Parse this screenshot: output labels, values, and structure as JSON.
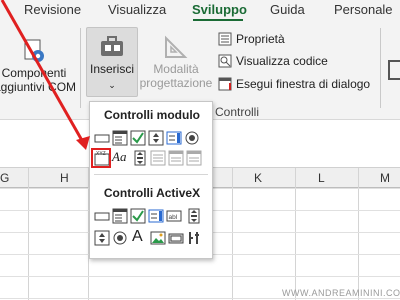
{
  "tabs": [
    "Revisione",
    "Visualizza",
    "Sviluppo",
    "Guida",
    "Personale"
  ],
  "active_tab": "Sviluppo",
  "ribbon": {
    "componenti_line1": "Componenti",
    "componenti_line2": "aggiuntivi COM",
    "inserisci_label": "Inserisci",
    "modalita_line1": "Modalità",
    "modalita_line2": "progettazione",
    "proprieta": "Proprietà",
    "visualizza_codice": "Visualizza codice",
    "esegui_finestra": "Esegui finestra di dialogo",
    "group_controlli": "Controlli"
  },
  "columns": [
    "G",
    "H",
    "K",
    "L",
    "M"
  ],
  "dropdown": {
    "controlli_modulo": "Controlli modulo",
    "controlli_activex": "Controlli ActiveX",
    "form_icons": [
      "button-icon",
      "combo-box-icon",
      "checkbox-icon",
      "list-box-icon",
      "option-button-icon",
      "label-icon",
      "group-box-icon",
      "scroll-bar-icon",
      "text-field-icon",
      "combo-list-edit-icon",
      "combo-dropdown-edit-icon"
    ],
    "activex_icons": [
      "command-button-icon",
      "combo-box-icon",
      "checkbox-icon",
      "list-box-icon",
      "text-box-icon",
      "scroll-bar-icon",
      "spin-button-icon",
      "option-button-icon",
      "label-icon",
      "image-icon",
      "toggle-button-icon",
      "more-controls-icon"
    ]
  },
  "colors": {
    "accent": "#1a6b35",
    "highlight": "#e02020"
  },
  "watermark": "WWW.ANDREAMININI.COM"
}
